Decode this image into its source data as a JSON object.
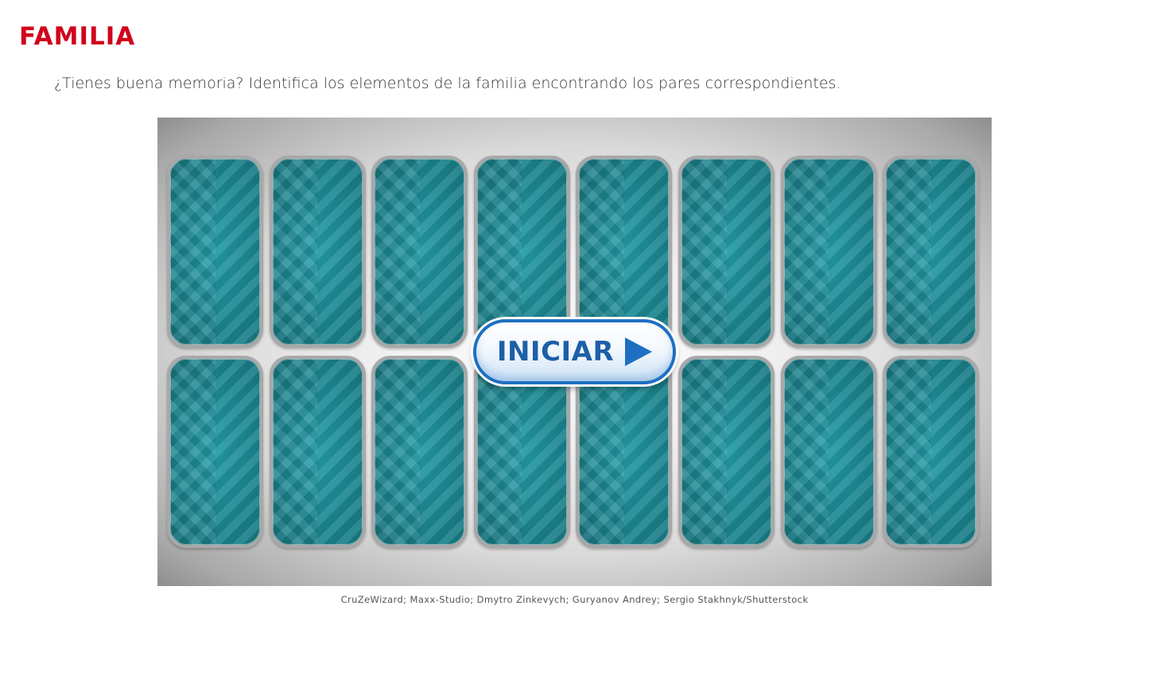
{
  "page": {
    "title": "FAMILIA",
    "instructions": "¿Tienes buena memoria? Identifica los elementos de la familia encontrando los pares correspondientes.",
    "credits": "CruZeWizard; Maxx-Studio; Dmytro Zinkevych; Guryanov Andrey; Sergio Stakhnyk/Shutterstock"
  },
  "game": {
    "start_label": "INICIAR",
    "rows": 2,
    "columns": 8,
    "card_count": 16,
    "card_state": "face-down",
    "colors": {
      "title": "#d0021b",
      "card_back": "#1b8a95",
      "button_border": "#1e6fc2",
      "button_text": "#1d5fa8"
    },
    "icons": {
      "start": "play-icon"
    }
  }
}
